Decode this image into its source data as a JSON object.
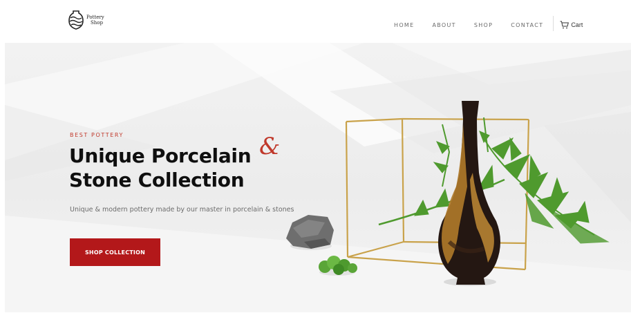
{
  "brand": {
    "name_line1": "Pottery",
    "name_line2": "Shop"
  },
  "nav": {
    "items": [
      {
        "label": "HOME"
      },
      {
        "label": "ABOUT"
      },
      {
        "label": "SHOP"
      },
      {
        "label": "CONTACT"
      }
    ],
    "cart_label": "Cart"
  },
  "hero": {
    "eyebrow": "BEST POTTERY",
    "title_line1": "Unique Porcelain",
    "title_line2": "Stone Collection",
    "ampersand": "&",
    "subtitle": "Unique & modern pottery made by our master in porcelain & stones",
    "cta_label": "SHOP COLLECTION"
  },
  "colors": {
    "accent": "#b3181a",
    "eyebrow": "#c0392b",
    "frame_gold": "#c9a24a",
    "fern_green": "#4f9a2e"
  }
}
